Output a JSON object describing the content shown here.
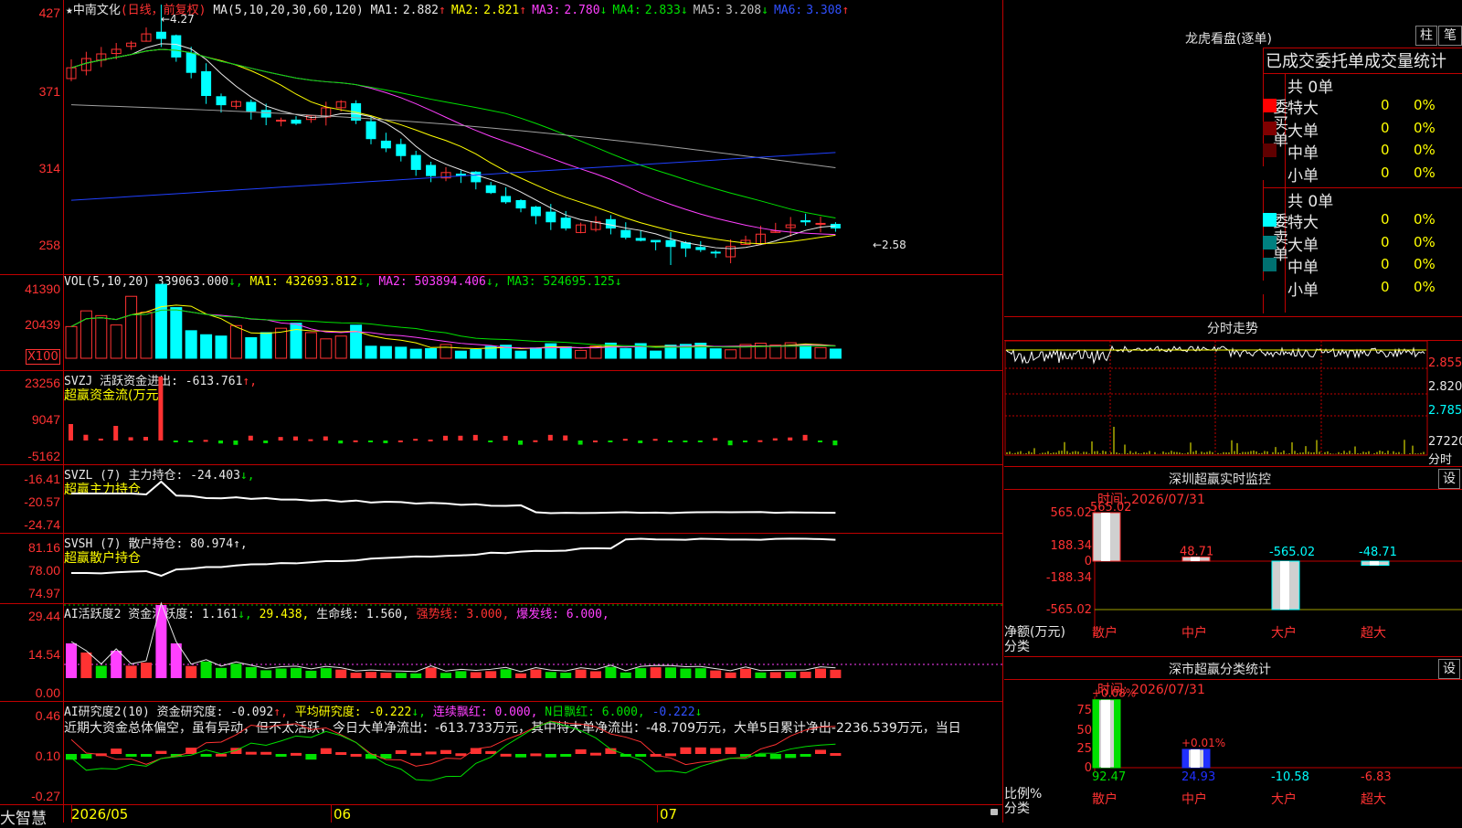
{
  "app": {
    "brand": "大智慧"
  },
  "main": {
    "title_star": "★",
    "title": "中南文化",
    "period": "(日线，前复权)",
    "ma_label": "MA(5,10,20,30,60,120)",
    "ma": [
      {
        "label": "MA1:",
        "value": "2.882",
        "arrow": "↑",
        "color": "#e8e8e8"
      },
      {
        "label": "MA2:",
        "value": "2.821",
        "arrow": "↑",
        "color": "#ffff00"
      },
      {
        "label": "MA3:",
        "value": "2.780",
        "arrow": "↓",
        "color": "#ff40ff"
      },
      {
        "label": "MA4:",
        "value": "2.833",
        "arrow": "↓",
        "color": "#00e000"
      },
      {
        "label": "MA5:",
        "value": "3.208",
        "arrow": "↓",
        "color": "#c0c0c0"
      },
      {
        "label": "MA6:",
        "value": "3.308",
        "arrow": "↑",
        "color": "#3050ff"
      }
    ],
    "high_note": "←4.27",
    "low_note": "←2.58",
    "axis": [
      "427",
      "371",
      "314",
      "258"
    ]
  },
  "vol": {
    "label": "VOL(5,10,20)",
    "value": "339063.000",
    "arrow": "↓,",
    "ma1": "MA1: 432693.812",
    "ma1_arrow": "↓,",
    "ma2": "MA2: 503894.406",
    "ma2_arrow": "↓,",
    "ma3": "MA3: 524695.125",
    "ma3_arrow": "↓",
    "axis": [
      "41390",
      "20439"
    ],
    "unit": "X100"
  },
  "svzj": {
    "label": "SVZJ  活跃资金进出:",
    "value": "-613.761",
    "arrow": "↑,",
    "sub": "超赢资金流(万元)",
    "axis": [
      "23256",
      "9047",
      "-5162"
    ]
  },
  "svzl": {
    "label": "SVZL (7) 主力持仓:",
    "value": "-24.403",
    "arrow": "↓,",
    "sub": "超赢主力持仓",
    "axis": [
      "-16.41",
      "-20.57",
      "-24.74"
    ]
  },
  "svsh": {
    "label": "SVSH (7) 散户持仓:",
    "value": "80.974",
    "arrow": "↑,",
    "sub": "超赢散户持仓",
    "axis": [
      "81.16",
      "78.00",
      "74.97"
    ]
  },
  "ai1": {
    "label": "AI活跃度2 资金活跃度:",
    "value": "1.161",
    "arrow": "↓,",
    "v2": "29.438,",
    "life": "生命线: 1.560,",
    "strong": "强势线: 3.000,",
    "burst": "爆发线: 6.000,",
    "axis": [
      "29.44",
      "14.54",
      "0.00"
    ]
  },
  "ai2": {
    "label": "AI研究度2(10) 资金研究度:",
    "value": "-0.092",
    "arrow": "↑,",
    "avg": "平均研究度: -0.222",
    "avg_arrow": "↓,",
    "red_streak": "连续飘红: 0.000,",
    "n_red": "N日飘红: 6.000,",
    "last": "-0.222",
    "last_arrow": "↓",
    "comment": "近期大资金总体偏空，虽有异动，但不太活跃，今日大单净流出：-613.733万元，其中特大单净流出：-48.709万元，大单5日累计净出-2236.539万元，当日",
    "axis": [
      "0.46",
      "0.10",
      "-0.27"
    ]
  },
  "dates": [
    "2026/05",
    "06",
    "07"
  ],
  "lhb": {
    "title": "龙虎看盘(逐单)",
    "btn1": "柱",
    "btn2": "笔",
    "tabs": "已成交委托单成交量统计",
    "buy_side": "委买单",
    "sell_side": "委卖单",
    "buy_total": "共 0单",
    "sell_total": "共 0单",
    "buy_rows": [
      {
        "name": "特大",
        "count": "0",
        "pct": "0%",
        "color": "#ff0000"
      },
      {
        "name": "大单",
        "count": "0",
        "pct": "0%",
        "color": "#800000"
      },
      {
        "name": "中单",
        "count": "0",
        "pct": "0%",
        "color": "#600000"
      },
      {
        "name": "小单",
        "count": "0",
        "pct": "0%",
        "color": "#000000"
      }
    ],
    "sell_rows": [
      {
        "name": "特大",
        "count": "0",
        "pct": "0%",
        "color": "#00ffff"
      },
      {
        "name": "大单",
        "count": "0",
        "pct": "0%",
        "color": "#008080"
      },
      {
        "name": "中单",
        "count": "0",
        "pct": "0%",
        "color": "#007070"
      },
      {
        "name": "小单",
        "count": "0",
        "pct": "0%",
        "color": "#000000"
      }
    ]
  },
  "fs": {
    "title": "分时走势",
    "axis": [
      "2.855",
      "2.820",
      "2.785",
      "27220"
    ],
    "unit": "分时"
  },
  "sz_monitor": {
    "title": "深圳超赢实时监控",
    "btn": "设",
    "time": "时间: 2026/07/31",
    "axis": [
      "565.02",
      "188.34",
      "0",
      "-188.34",
      "-565.02"
    ],
    "ylabel": "净额(万元)",
    "xlabel": "分类",
    "categories": [
      "散户",
      "中户",
      "大户",
      "超大"
    ],
    "values": [
      "565.02",
      "48.71",
      "-565.02",
      "-48.71"
    ]
  },
  "sz_class": {
    "title": "深市超赢分类统计",
    "btn": "设",
    "time": "时间: 2026/07/31",
    "axis": [
      "75",
      "50",
      "25",
      "0"
    ],
    "ylabel": "比例%",
    "xlabel": "分类",
    "pct_labels": [
      "+0.08%",
      "+0.01%"
    ],
    "categories": [
      "散户",
      "中户",
      "大户",
      "超大"
    ],
    "values": [
      "92.47",
      "24.93",
      "-10.58",
      "-6.83"
    ]
  },
  "chart_data": {
    "type": "candlestick",
    "title": "中南文化 (日线，前复权)",
    "x": [
      "2026/05",
      "06",
      "07"
    ],
    "price_ticks": [
      4.27,
      3.71,
      3.14,
      2.58
    ],
    "high": 4.27,
    "low": 2.58,
    "last_ma": {
      "MA5": 2.882,
      "MA10": 2.821,
      "MA20": 2.78,
      "MA30": 2.833,
      "MA60": 3.208,
      "MA120": 3.308
    },
    "close_series": [
      3.86,
      3.92,
      3.95,
      3.98,
      4.02,
      4.08,
      4.05,
      3.93,
      3.83,
      3.68,
      3.62,
      3.64,
      3.58,
      3.54,
      3.52,
      3.5,
      3.55,
      3.6,
      3.64,
      3.52,
      3.4,
      3.34,
      3.29,
      3.2,
      3.16,
      3.18,
      3.16,
      3.12,
      3.05,
      2.99,
      2.95,
      2.9,
      2.86,
      2.82,
      2.84,
      2.86,
      2.82,
      2.76,
      2.74,
      2.73,
      2.7,
      2.69,
      2.68,
      2.66,
      2.7,
      2.74,
      2.78,
      2.8,
      2.84,
      2.86,
      2.85,
      2.82
    ]
  }
}
